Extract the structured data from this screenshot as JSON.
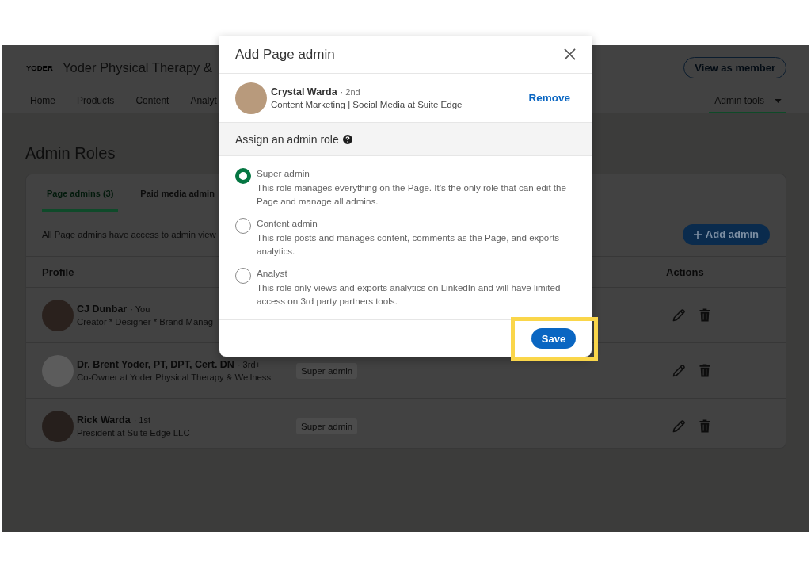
{
  "screen": {
    "header": {
      "logo": "YODER",
      "title": "Yoder Physical Therapy &",
      "view_button": "View as member",
      "nav": [
        {
          "label": "Home",
          "selected": false
        },
        {
          "label": "Products",
          "selected": false
        },
        {
          "label": "Content",
          "selected": false
        },
        {
          "label": "Analyt",
          "selected": false
        }
      ],
      "admin_tools": {
        "label": "Admin tools",
        "selected": true
      }
    },
    "heading": "Admin Roles",
    "tabs": [
      {
        "label": "Page admins (3)",
        "selected": true
      },
      {
        "label": "Paid media admin",
        "selected": false
      }
    ],
    "info": "All Page admins have access to admin view",
    "add_button": "Add admin",
    "table": {
      "columns": [
        "Profile",
        "Actions"
      ],
      "rows": [
        {
          "name": "CJ Dunbar",
          "degree": "· You",
          "headline": "Creator * Designer * Brand Manag"
        },
        {
          "name": "Dr. Brent Yoder, PT, DPT, Cert. DN",
          "degree": "· 3rd+",
          "headline": "Co-Owner at Yoder Physical Therapy & Wellness",
          "role": "Super admin"
        },
        {
          "name": "Rick Warda",
          "degree": "· 1st",
          "headline": "President at Suite Edge LLC",
          "role": "Super admin"
        }
      ]
    }
  },
  "modal": {
    "title": "Add Page admin",
    "person": {
      "name": "Crystal Warda",
      "degree": "· 2nd",
      "headline": "Content Marketing | Social Media at Suite Edge",
      "action": "Remove"
    },
    "section_title": "Assign an admin role",
    "roles": [
      {
        "name": "Super admin",
        "description": "This role manages everything on the Page. It’s the only role that can edit the Page and manage all admins.",
        "selected": true
      },
      {
        "name": "Content admin",
        "description": "This role posts and manages content, comments as the Page, and exports analytics.",
        "selected": false
      },
      {
        "name": "Analyst",
        "description": "This role only views and exports analytics on LinkedIn and will have limited access on 3rd party partners tools.",
        "selected": false
      }
    ],
    "save": {
      "label": "Save",
      "highlighted": true
    }
  }
}
